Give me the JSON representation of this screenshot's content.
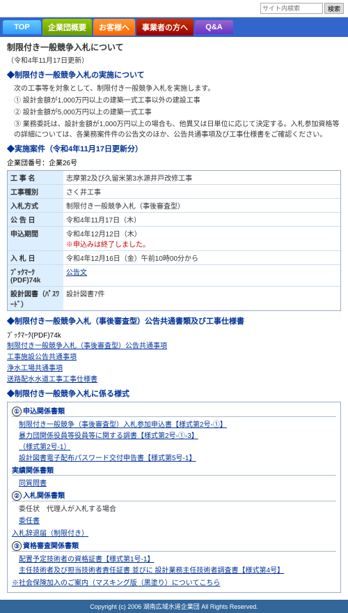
{
  "header": {
    "search_placeholder": "サイト内検索",
    "search_button": "検索"
  },
  "nav": {
    "items": [
      {
        "id": "top",
        "label": "TOP",
        "class": "top"
      },
      {
        "id": "kigyou",
        "label": "企業団概要",
        "class": "kigyou"
      },
      {
        "id": "okyaku",
        "label": "お客様へ",
        "class": "okyaku"
      },
      {
        "id": "jigyou",
        "label": "事業者の方へ",
        "class": "jigyou"
      },
      {
        "id": "qa",
        "label": "Q&A",
        "class": "qa"
      }
    ]
  },
  "page": {
    "title": "制限付き一般競争入札について",
    "subtitle": "（令和4年11月17日更新）",
    "section1_title": "◆制限付き一般競争入札の実施について",
    "bullets": [
      "次の工事等を対象として、制限付き一般競争入札を実施します。",
      "① 設計金額が1,000万円以上の建築一式工事以外の建設工事",
      "② 設計金額が5,000万円以上の建築一式工事",
      "③ 業務委託は、設計金額が1,000万円以上の場合も、他異又は日単位に応じて決定する。入札参加資格等の詳細については、各業務案件件の公告文のほか、公告共通事項及び工事仕様書をご確認ください。"
    ],
    "section2_title": "◆実施案件（令和4年11月17日更新分）",
    "kiji_label": "企業団番号：企業26号",
    "detail_rows": [
      {
        "label": "工 事 名",
        "value": "志摩第2及び久留米第3水源井戸改修工事"
      },
      {
        "label": "工事種別",
        "value": "さく井工事"
      },
      {
        "label": "入札方式",
        "value": "制限付き一般競争入札（事後審査型）"
      },
      {
        "label": "公 告 日",
        "value": "令和4年11月17日（木）"
      },
      {
        "label": "申込期間",
        "value": "令和4年12月12日（木）",
        "extra": "※申込みは終了しました。"
      },
      {
        "label": "入 札 日",
        "value": "令和4年12月16日（金）午前10時00分から"
      },
      {
        "label": "ﾌﾞｯｸﾏｰｸ(PDF)74k",
        "value": "公告文"
      },
      {
        "label": "設計図書（ﾊﾟｽﾜｰﾄﾞ）",
        "value": "設計図書7件"
      }
    ],
    "section3_title": "◆制限付き一般競争入札（事後審査型）公告共通書類及び工事仕様書",
    "section3_link1": "ﾌﾞｯｸﾏｰｸ(PDF)74k",
    "section3_links": [
      "制限付き一般競争入札（事後審査型）公告共通事項",
      "工事施設公告共通事項",
      "浄水工場共通事項",
      "送路配水水道工事工事仕様書"
    ],
    "section4_title": "◆制限付き一般競争入札に係る様式",
    "form_groups": [
      {
        "id": "shinsei",
        "label": "①申込関係書類",
        "items": [
          "制限付き一般競争（事後審査型）入札参加申込書【様式第2号-①】",
          "暴力団関係役員等役員等に関する調書【様式第2号-①-3】",
          "（様式第2号-1）",
          "設計図書電子配布パスワード交付申告書【様式第5号-1】"
        ]
      },
      {
        "id": "jissen",
        "label": "実績関係書類",
        "items": [
          "同質問書"
        ]
      },
      {
        "id": "nyusatsu",
        "label": "②入札関係書類",
        "sub": [
          {
            "label": "委任状　代理人が入札する場合"
          },
          {
            "label": "委任書"
          }
        ]
      },
      {
        "id": "nyusatsu2",
        "label": "入札辞退届（制限付き）"
      },
      {
        "id": "shikaku",
        "label": "③資格審査関係書類",
        "items": [
          "配置予定技術者の資格証書【様式第1号-1】",
          "主任技術者及び担当技術者責任証書 並びに 設計業務主任技術者調査書【様式第4号】"
        ]
      },
      {
        "id": "hoken",
        "label": "※社会保険加入のご案内（マスキング版（黒塗り）についてこちら"
      }
    ],
    "footer_text": "Copyright (c) 2006 湖南広域水道企業団 All Rights Reserved."
  }
}
